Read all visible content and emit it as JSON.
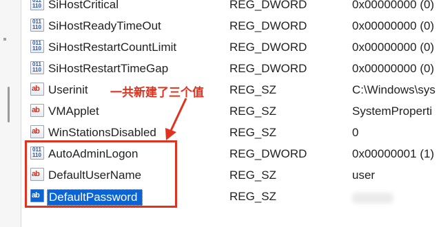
{
  "rows": [
    {
      "icon": "dword",
      "name": "SiHostCritical",
      "type": "REG_DWORD",
      "data": "0x00000000 (0)"
    },
    {
      "icon": "dword",
      "name": "SiHostReadyTimeOut",
      "type": "REG_DWORD",
      "data": "0x00000000 (0)"
    },
    {
      "icon": "dword",
      "name": "SiHostRestartCountLimit",
      "type": "REG_DWORD",
      "data": "0x00000000 (0)"
    },
    {
      "icon": "dword",
      "name": "SiHostRestartTimeGap",
      "type": "REG_DWORD",
      "data": "0x00000000 (0)"
    },
    {
      "icon": "string",
      "name": "Userinit",
      "type": "REG_SZ",
      "data": "C:\\Windows\\sys"
    },
    {
      "icon": "string",
      "name": "VMApplet",
      "type": "REG_SZ",
      "data": "SystemProperti"
    },
    {
      "icon": "string",
      "name": "WinStationsDisabled",
      "type": "REG_SZ",
      "data": "0"
    },
    {
      "icon": "dword",
      "name": "AutoAdminLogon",
      "type": "REG_DWORD",
      "data": "0x00000001 (1)"
    },
    {
      "icon": "string",
      "name": "DefaultUserName",
      "type": "REG_SZ",
      "data": "user"
    },
    {
      "icon": "string",
      "name": "DefaultPassword",
      "type": "REG_SZ",
      "data": ""
    }
  ],
  "annotation": {
    "text": "一共新建了三个值",
    "color": "#e0321e"
  },
  "icons": {
    "string_glyph": "ab",
    "binary_glyph": "011\n110"
  },
  "colors": {
    "selection": "#0a64d6",
    "annotation_red": "#e0321e"
  }
}
